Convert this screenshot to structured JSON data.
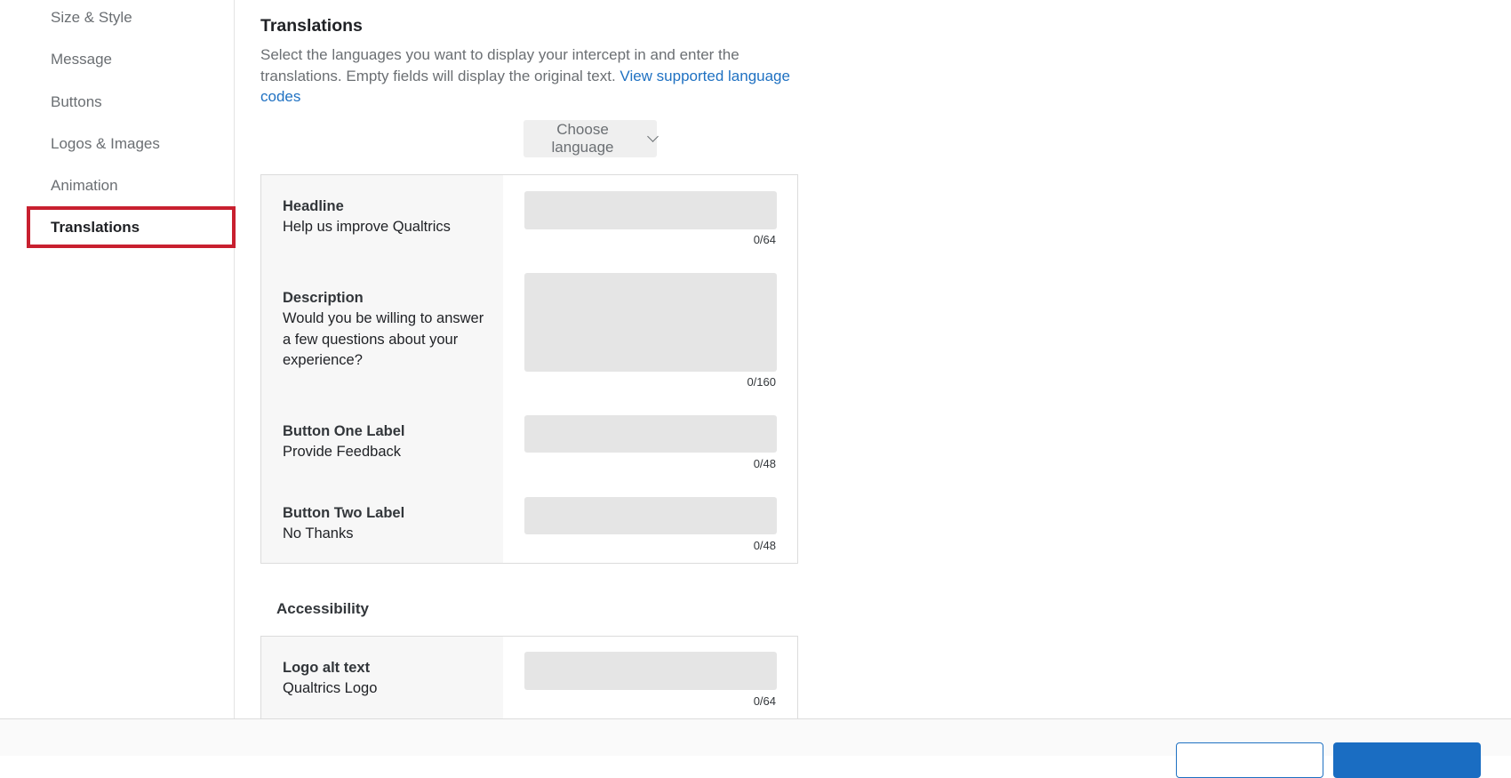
{
  "sidebar": {
    "items": [
      {
        "label": "Size & Style"
      },
      {
        "label": "Message"
      },
      {
        "label": "Buttons"
      },
      {
        "label": "Logos & Images"
      },
      {
        "label": "Animation"
      },
      {
        "label": "Translations"
      }
    ],
    "active": "Translations"
  },
  "translations": {
    "title": "Translations",
    "intro": "Select the languages you want to display your intercept in and enter the translations. Empty fields will display the original text. ",
    "link": "View supported language codes",
    "language_button": "Choose language",
    "fields": [
      {
        "label": "Headline",
        "original": "Help us improve Qualtrics",
        "value": "",
        "counter": "0/64"
      },
      {
        "label": "Description",
        "original": "Would you be willing to answer a few questions about your experience?",
        "value": "",
        "counter": "0/160"
      },
      {
        "label": "Button One Label",
        "original": "Provide Feedback",
        "value": "",
        "counter": "0/48"
      },
      {
        "label": "Button Two Label",
        "original": "No Thanks",
        "value": "",
        "counter": "0/48"
      }
    ]
  },
  "accessibility": {
    "title": "Accessibility",
    "fields": [
      {
        "label": "Logo alt text",
        "original": "Qualtrics Logo",
        "value": "",
        "counter": "0/64"
      }
    ]
  },
  "colors": {
    "accent": "#1f71c2",
    "highlight": "#c8202f"
  }
}
